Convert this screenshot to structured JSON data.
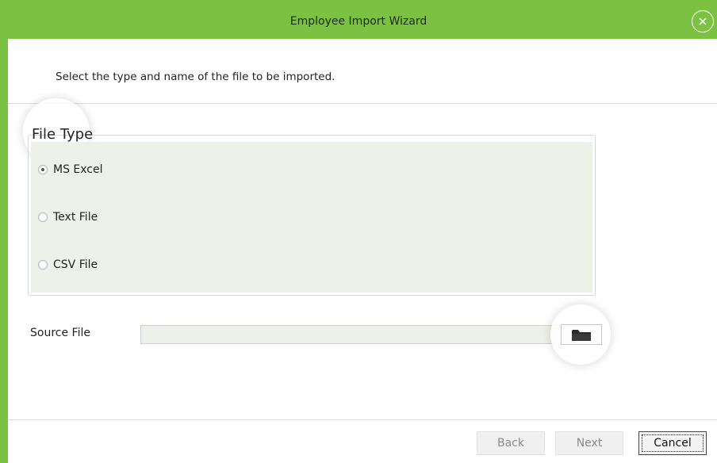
{
  "window": {
    "title": "Employee Import Wizard",
    "accent_color": "#7bc142",
    "close_icon": "close-circle-icon"
  },
  "instruction": "Select the type and name of the file to be imported.",
  "file_type": {
    "legend": "File Type",
    "selected": "MS Excel",
    "options": [
      {
        "label": "MS Excel",
        "checked": true
      },
      {
        "label": "Text File",
        "checked": false
      },
      {
        "label": "CSV File",
        "checked": false
      }
    ]
  },
  "source_file": {
    "label": "Source File",
    "value": "",
    "browse_icon": "folder-icon"
  },
  "buttons": {
    "back": "Back",
    "next": "Next",
    "cancel": "Cancel"
  }
}
